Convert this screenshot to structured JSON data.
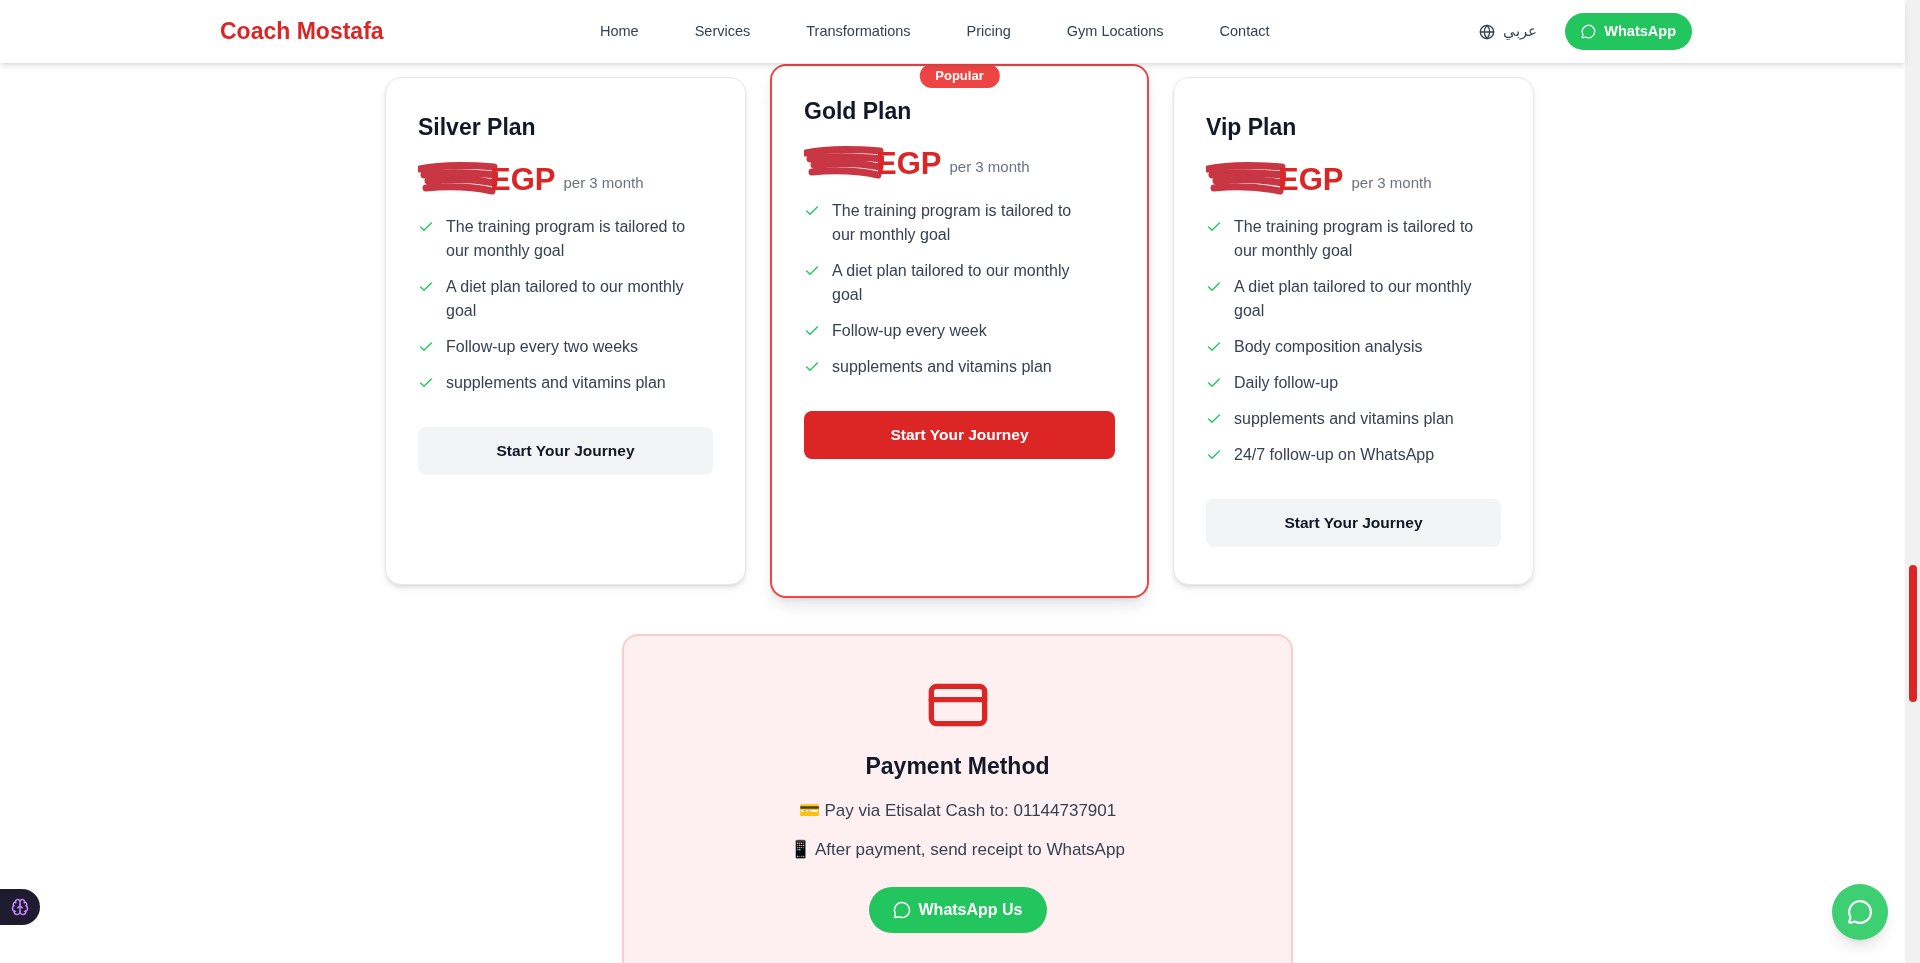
{
  "header": {
    "logo": "Coach Mostafa",
    "nav": [
      "Home",
      "Services",
      "Transformations",
      "Pricing",
      "Gym Locations",
      "Contact"
    ],
    "language": "عربي",
    "whatsapp_button": "WhatsApp"
  },
  "plans": [
    {
      "name": "Silver Plan",
      "currency": "EGP",
      "period": "per 3 month",
      "featured": false,
      "features": [
        "The training program is tailored to our monthly goal",
        "A diet plan tailored to our monthly goal",
        "Follow-up every two weeks",
        "supplements and vitamins plan"
      ],
      "button": "Start Your Journey"
    },
    {
      "name": "Gold Plan",
      "badge": "Popular",
      "currency": "EGP",
      "period": "per 3 month",
      "featured": true,
      "features": [
        "The training program is tailored to our monthly goal",
        "A diet plan tailored to our monthly goal",
        "Follow-up every week",
        "supplements and vitamins plan"
      ],
      "button": "Start Your Journey"
    },
    {
      "name": "Vip Plan",
      "currency": "EGP",
      "period": "per 3 month",
      "featured": false,
      "features": [
        "The training program is tailored to our monthly goal",
        "A diet plan tailored to our monthly goal",
        "Body composition analysis",
        "Daily follow-up",
        "supplements and vitamins plan",
        "24/7 follow-up on WhatsApp"
      ],
      "button": "Start Your Journey"
    }
  ],
  "payment": {
    "title": "Payment Method",
    "lines": [
      "💳 Pay via Etisalat Cash to: 01144737901",
      "📱 After payment, send receipt to WhatsApp"
    ],
    "button": "WhatsApp Us"
  }
}
